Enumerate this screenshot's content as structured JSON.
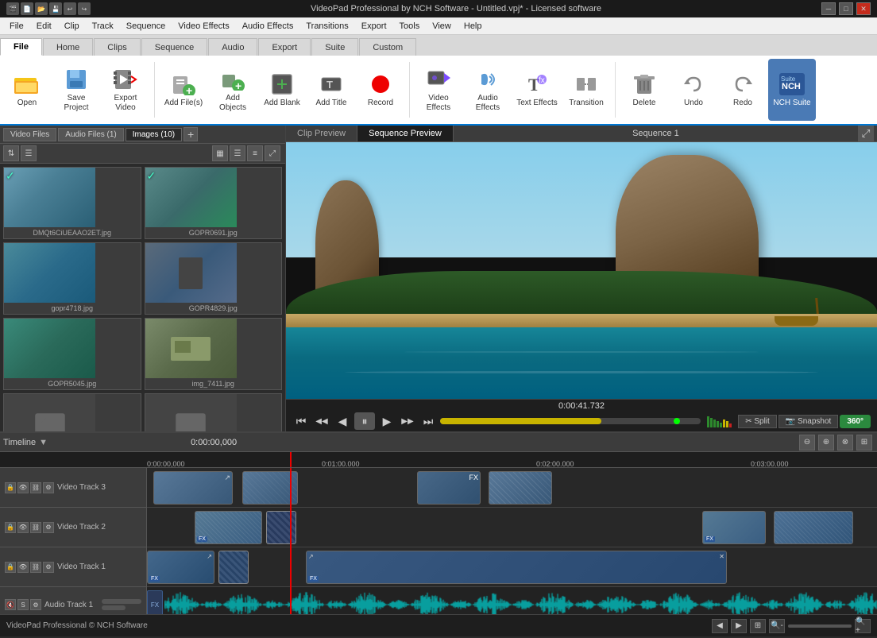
{
  "titleBar": {
    "title": "VideoPad Professional by NCH Software - Untitled.vpj* - Licensed software",
    "minBtn": "─",
    "maxBtn": "□",
    "closeBtn": "✕"
  },
  "menuBar": {
    "items": [
      "File",
      "Edit",
      "Clip",
      "Track",
      "Sequence",
      "Video Effects",
      "Audio Effects",
      "Transitions",
      "Export",
      "Tools",
      "View",
      "Help"
    ]
  },
  "ribbonTabs": {
    "tabs": [
      "File",
      "Home",
      "Clips",
      "Sequence",
      "Audio",
      "Export",
      "Suite",
      "Custom"
    ],
    "activeTab": "Home"
  },
  "ribbon": {
    "buttons": [
      {
        "label": "Open",
        "icon": "folder-open"
      },
      {
        "label": "Save Project",
        "icon": "save"
      },
      {
        "label": "Export Video",
        "icon": "film"
      },
      {
        "label": "Add File(s)",
        "icon": "add-files"
      },
      {
        "label": "Add Objects",
        "icon": "add-objects"
      },
      {
        "label": "Add Blank",
        "icon": "add-blank"
      },
      {
        "label": "Add Title",
        "icon": "add-title"
      },
      {
        "label": "Record",
        "icon": "record"
      },
      {
        "label": "Video Effects",
        "icon": "video-effects"
      },
      {
        "label": "Audio Effects",
        "icon": "audio-effects"
      },
      {
        "label": "Text Effects",
        "icon": "text-effects"
      },
      {
        "label": "Transition",
        "icon": "transition"
      },
      {
        "label": "Delete",
        "icon": "delete"
      },
      {
        "label": "Undo",
        "icon": "undo"
      },
      {
        "label": "Redo",
        "icon": "redo"
      },
      {
        "label": "NCH Suite",
        "icon": "nch-suite"
      }
    ]
  },
  "fileTabs": {
    "tabs": [
      "Video Files",
      "Audio Files (1)",
      "Images (10)"
    ],
    "activeTab": "Images (10)"
  },
  "viewControls": [
    "list-view",
    "grid-view",
    "detail-view",
    "filter"
  ],
  "images": [
    {
      "filename": "DMQt6CiUEAAO2ET.jpg",
      "checked": true,
      "color": "#6a9fb5"
    },
    {
      "filename": "GOPR0691.jpg",
      "checked": true,
      "color": "#7a9a7a"
    },
    {
      "filename": "gopr4718.jpg",
      "checked": false,
      "color": "#5a8a9a"
    },
    {
      "filename": "GOPR4829.jpg",
      "checked": false,
      "color": "#5a7a8a"
    },
    {
      "filename": "GOPR5045.jpg",
      "checked": false,
      "color": "#4a8a7a"
    },
    {
      "filename": "img_7411.jpg",
      "checked": false,
      "color": "#7a8a5a"
    },
    {
      "filename": "",
      "checked": false,
      "color": "#444",
      "isPlaceholder": true
    },
    {
      "filename": "",
      "checked": false,
      "color": "#444",
      "isPlaceholder": true
    }
  ],
  "preview": {
    "tabs": [
      "Clip Preview",
      "Sequence Preview"
    ],
    "activeTab": "Sequence Preview",
    "sequenceTitle": "Sequence 1",
    "timeCode": "0:00:41.732"
  },
  "playbackControls": {
    "skipBack": "⏮",
    "prevFrame": "⏭",
    "rewind": "◀",
    "pause": "⏸",
    "play": "▶",
    "nextFrame": "⏭",
    "skipForward": "⏭"
  },
  "timeline": {
    "label": "Timeline",
    "timeMarkers": [
      "0:00:00,000",
      "0:01:00.000",
      "0:02:00.000",
      "0:03:00.000"
    ],
    "tracks": [
      {
        "name": "Video Track 3",
        "type": "video"
      },
      {
        "name": "Video Track 2",
        "type": "video"
      },
      {
        "name": "Video Track 1",
        "type": "video"
      },
      {
        "name": "Audio Track 1",
        "type": "audio"
      }
    ]
  },
  "statusBar": {
    "copyright": "VideoPad Professional © NCH Software"
  }
}
